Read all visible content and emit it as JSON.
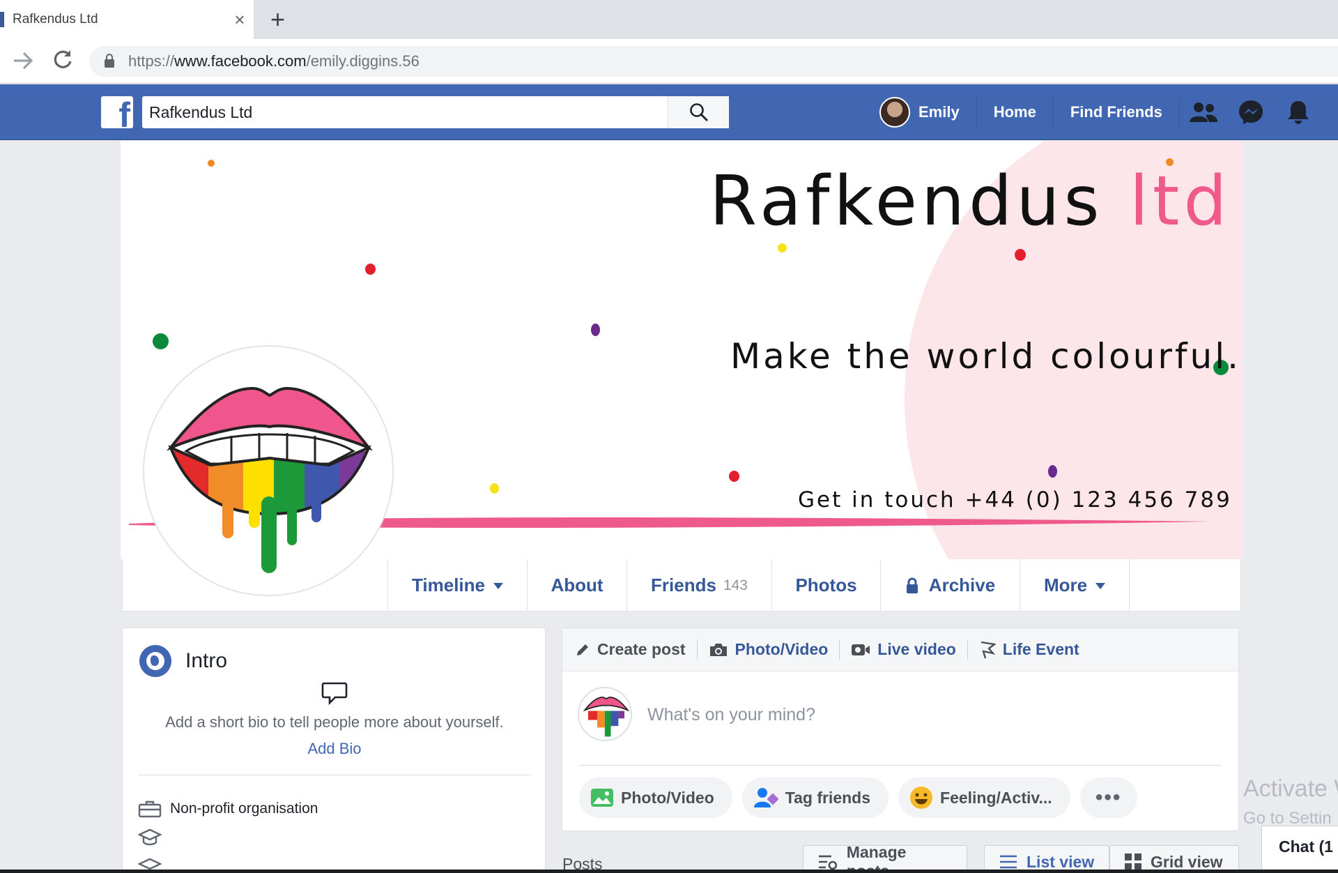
{
  "browser": {
    "tab_title": "Rafkendus Ltd",
    "close_glyph": "×",
    "new_tab_glyph": "+",
    "url_scheme": "https://",
    "url_host": "www.facebook.com",
    "url_path": "/emily.diggins.56"
  },
  "fb_header": {
    "logo_letter": "f",
    "search_value": "Rafkendus Ltd",
    "user_name": "Emily",
    "nav_home": "Home",
    "nav_find_friends": "Find Friends",
    "icons": [
      "friend-requests-icon",
      "messenger-icon",
      "notifications-icon"
    ],
    "brand_color": "#4267b2"
  },
  "cover": {
    "title_main": "Rafkendus ",
    "title_accent": "ltd",
    "tagline": "Make the world colourful.",
    "contact": "Get in touch +44 (0) 123 456 789",
    "accent_color": "#ef5a8d",
    "blob_color": "#fde6ea"
  },
  "profile_tabs": {
    "timeline": "Timeline",
    "about": "About",
    "friends": "Friends",
    "friends_count": "143",
    "photos": "Photos",
    "archive": "Archive",
    "more": "More"
  },
  "intro": {
    "title": "Intro",
    "bio_prompt": "Add a short bio to tell people more about yourself.",
    "add_bio": "Add Bio",
    "category": "Non-profit organisation"
  },
  "composer": {
    "tab_create_post": "Create post",
    "tab_photo_video": "Photo/Video",
    "tab_live_video": "Live video",
    "tab_life_event": "Life Event",
    "placeholder": "What's on your mind?",
    "btn_photo_video": "Photo/Video",
    "btn_tag_friends": "Tag friends",
    "btn_feeling": "Feeling/Activ...",
    "btn_more": "•••"
  },
  "posts": {
    "label": "Posts",
    "manage": "Manage posts",
    "list_view": "List view",
    "grid_view": "Grid view"
  },
  "overlay": {
    "activate_line1": "Activate W",
    "activate_line2": "Go to Settin",
    "chat": "Chat (1"
  }
}
